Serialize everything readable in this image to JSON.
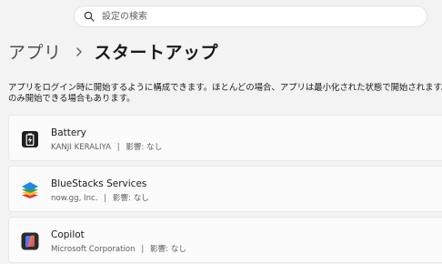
{
  "search": {
    "placeholder": "設定の検索"
  },
  "breadcrumb": {
    "parent": "アプリ",
    "separator_icon": "chevron-right-icon",
    "current": "スタートアップ"
  },
  "description": {
    "line1": "アプリをログイン時に開始するように構成できます。ほとんどの場合、アプリは最小化された状態で開始されます。",
    "line2": "のみ開始できる場合もあります。"
  },
  "apps": [
    {
      "name": "Battery",
      "publisher": "KANJI KERALIYA",
      "impact": "影響: なし",
      "icon": "battery-icon"
    },
    {
      "name": "BlueStacks Services",
      "publisher": "now.gg, Inc.",
      "impact": "影響: なし",
      "icon": "bluestacks-icon"
    },
    {
      "name": "Copilot",
      "publisher": "Microsoft Corporation",
      "impact": "影響: なし",
      "icon": "copilot-icon"
    }
  ],
  "meta_separator": "|",
  "colors": {
    "background": "#f3f3f3",
    "card": "#fbfbfb",
    "text_primary": "#1a1a1a",
    "text_secondary": "#5f5f5f"
  }
}
